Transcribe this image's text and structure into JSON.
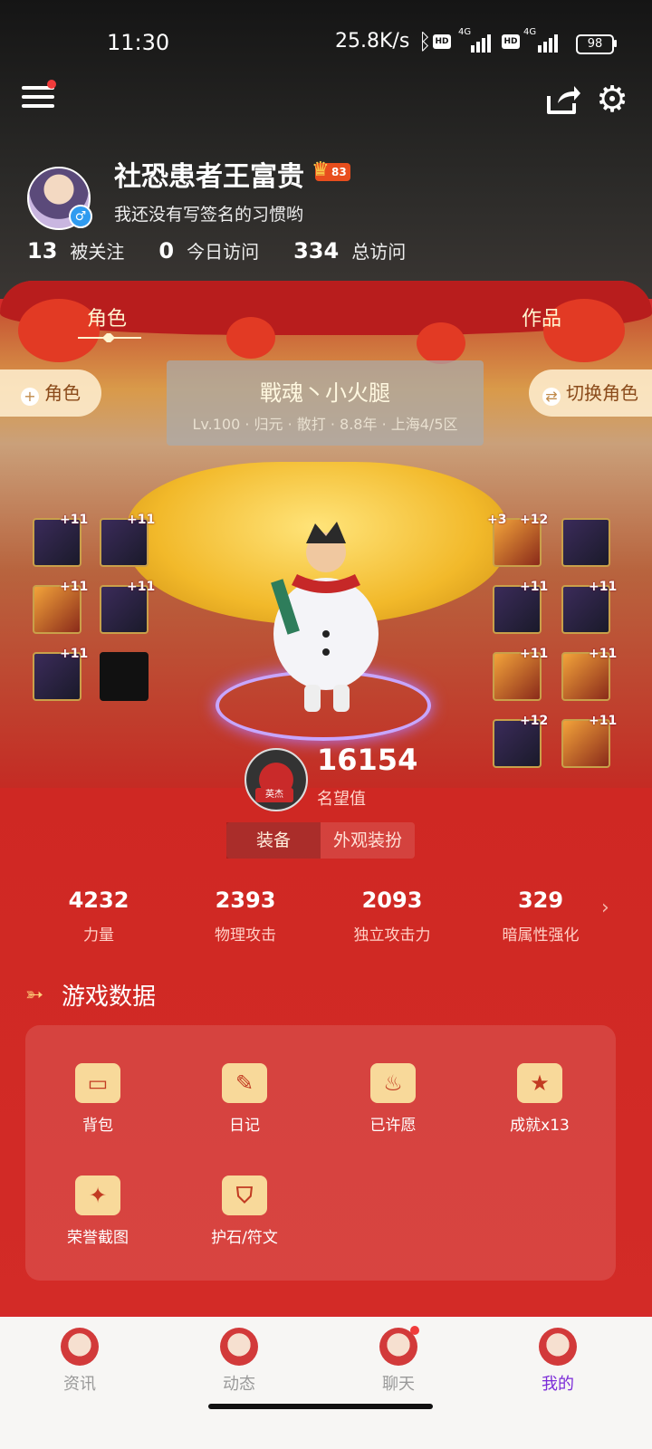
{
  "status": {
    "time": "11:30",
    "net_speed": "25.8K/s",
    "network1": "4G",
    "network2": "4G",
    "hd": "HD",
    "battery": "98"
  },
  "profile": {
    "name": "社恐患者王富贵",
    "level_badge": "83",
    "signature": "我还没有写签名的习惯哟",
    "stats": [
      {
        "value": "13",
        "label": "被关注"
      },
      {
        "value": "0",
        "label": "今日访问"
      },
      {
        "value": "334",
        "label": "总访问"
      }
    ]
  },
  "scene": {
    "tab_role": "角色",
    "tab_work": "作品",
    "add_role_btn": "角色",
    "switch_role_btn": "切换角色",
    "character_name": "戰魂丶小火腿",
    "character_meta": "Lv.100 · 归元 · 散打 · 8.8年 · 上海4/5区",
    "fame_badge": "英杰",
    "fame_value": "16154",
    "fame_label": "名望值",
    "segments": [
      "装备",
      "外观装扮"
    ],
    "active_segment": "装备",
    "left_equip": [
      {
        "plus": "+11"
      },
      {
        "plus": "+11"
      },
      {
        "plus": "+11"
      },
      {
        "plus": "+11"
      },
      {
        "plus": "+11"
      },
      {
        "plus": ""
      }
    ],
    "right_equip": [
      {
        "plus": "+3",
        "plus2": "+12"
      },
      {
        "plus": ""
      },
      {
        "plus": "+11"
      },
      {
        "plus": "+11"
      },
      {
        "plus": "+11"
      },
      {
        "plus": "+11"
      },
      {
        "plus": "+12"
      },
      {
        "plus": "+11"
      }
    ]
  },
  "attributes": [
    {
      "value": "4232",
      "label": "力量"
    },
    {
      "value": "2393",
      "label": "物理攻击"
    },
    {
      "value": "2093",
      "label": "独立攻击力"
    },
    {
      "value": "329",
      "label": "暗属性强化"
    }
  ],
  "game_data": {
    "title": "游戏数据",
    "items": [
      {
        "label": "背包",
        "icon": "bag-icon"
      },
      {
        "label": "日记",
        "icon": "diary-icon"
      },
      {
        "label": "已许愿",
        "icon": "wish-icon"
      },
      {
        "label": "成就x13",
        "icon": "achievement-icon"
      },
      {
        "label": "荣誉截图",
        "icon": "honor-screenshot-icon"
      },
      {
        "label": "护石/符文",
        "icon": "talisman-icon"
      }
    ]
  },
  "nav": {
    "items": [
      {
        "label": "资讯"
      },
      {
        "label": "动态"
      },
      {
        "label": "聊天"
      },
      {
        "label": "我的"
      }
    ],
    "active": "我的",
    "active_color": "#7b2bd8"
  }
}
